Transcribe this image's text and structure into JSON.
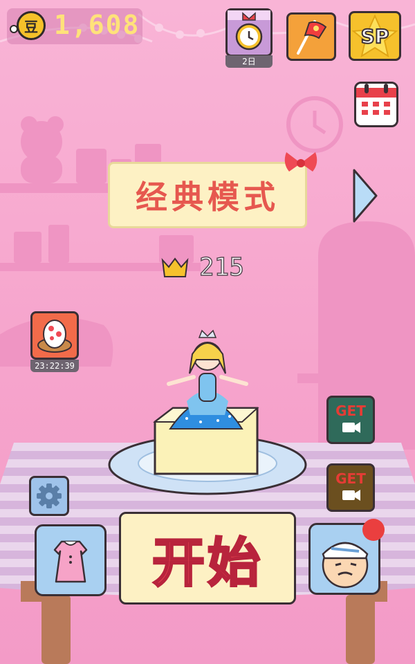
{
  "hud": {
    "coins": "1,608",
    "coin_icon": "coin-icon",
    "alarm_label": "2日"
  },
  "top_buttons": {
    "sp_label": "SP"
  },
  "mode": {
    "title": "经典模式"
  },
  "score": {
    "crowns": "215"
  },
  "egg": {
    "timer": "23:22:39"
  },
  "rewards": {
    "get_label_1": "GET",
    "get_label_2": "GET"
  },
  "start": {
    "label": "开始"
  },
  "colors": {
    "background": "#f7a9cf",
    "banner": "#fdf1c4",
    "accent_red": "#ef4a54",
    "coin_gold": "#f5c12a"
  }
}
